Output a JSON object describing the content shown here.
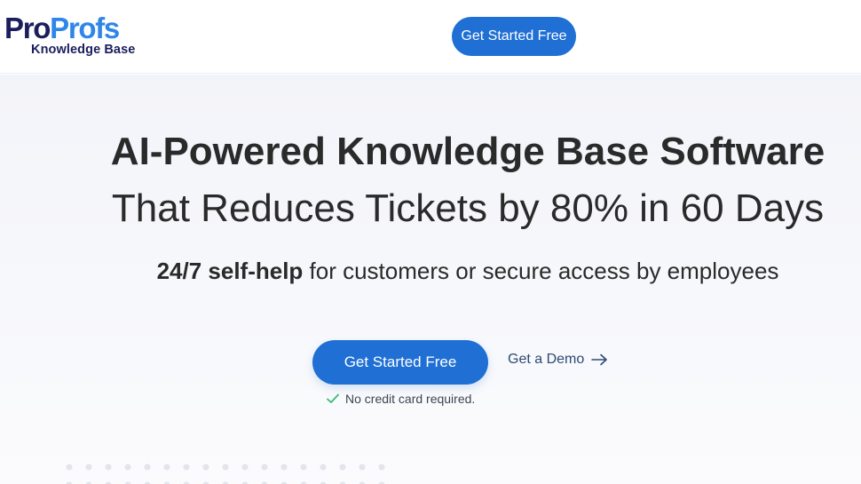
{
  "header": {
    "logo": {
      "wordmark_pro": "Pro",
      "wordmark_profs": "Profs",
      "subtitle": "Knowledge Base"
    },
    "cta_label": "Get Started Free"
  },
  "hero": {
    "title_line1": "AI-Powered Knowledge Base Software",
    "title_line2": "That Reduces Tickets by 80% in 60 Days",
    "subtitle_bold": "24/7 self-help",
    "subtitle_rest": " for customers or secure access by employees",
    "primary_cta_label": "Get Started Free",
    "demo_link_label": "Get a Demo",
    "note": "No credit card required."
  },
  "colors": {
    "brand_navy": "#1b1e5c",
    "brand_blue": "#2f86e8",
    "button_blue": "#1f6fd4",
    "check_green": "#3cb878"
  },
  "icons": {
    "arrow": "arrow-right-icon",
    "check": "check-icon"
  }
}
